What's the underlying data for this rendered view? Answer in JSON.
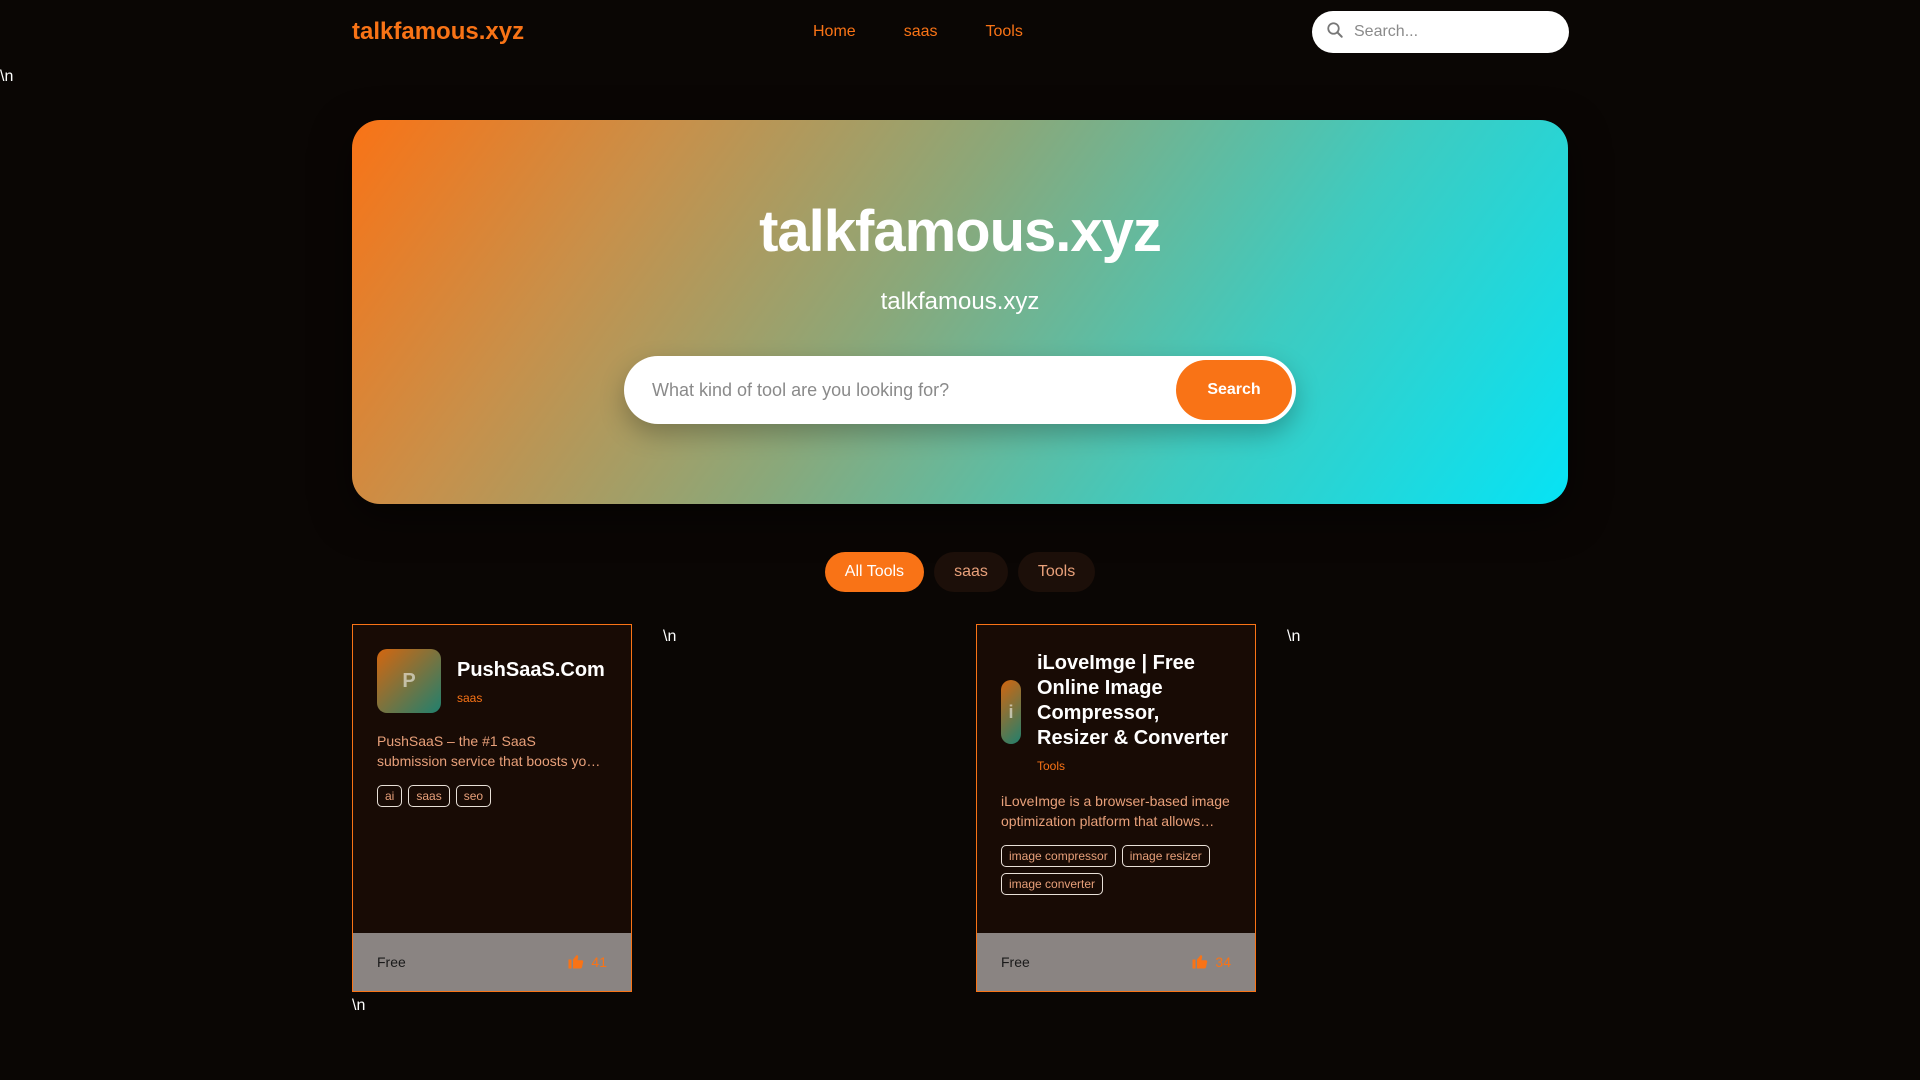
{
  "header": {
    "brand": "talkfamous.xyz",
    "nav": [
      "Home",
      "saas",
      "Tools"
    ],
    "search_placeholder": "Search..."
  },
  "stray_text": "\\n",
  "hero": {
    "title": "talkfamous.xyz",
    "subtitle": "talkfamous.xyz",
    "search_placeholder": "What kind of tool are you looking for?",
    "search_button": "Search"
  },
  "filters": {
    "tabs": [
      "All Tools",
      "saas",
      "Tools"
    ],
    "active": "All Tools"
  },
  "cards": [
    {
      "avatar_letter": "P",
      "title": "PushSaaS.Com",
      "category": "saas",
      "description": "PushSaaS – the #1 SaaS submission service that boosts yo…",
      "tags": [
        "ai",
        "saas",
        "seo"
      ],
      "price": "Free",
      "likes": "41"
    },
    {
      "avatar_letter": "i",
      "title": "iLoveImge | Free Online Image Compressor, Resizer & Converter",
      "category": "Tools",
      "description": "iLoveImge is a browser-based image optimization platform that allows…",
      "tags": [
        "image compressor",
        "image resizer",
        "image converter"
      ],
      "price": "Free",
      "likes": "34"
    }
  ],
  "colors": {
    "accent": "#f97316",
    "background": "#0a0604",
    "card_bg": "#180b05",
    "footer_bg": "#8a8482"
  },
  "icons": {
    "top_search": "search-icon",
    "like": "thumbs-up-icon"
  }
}
